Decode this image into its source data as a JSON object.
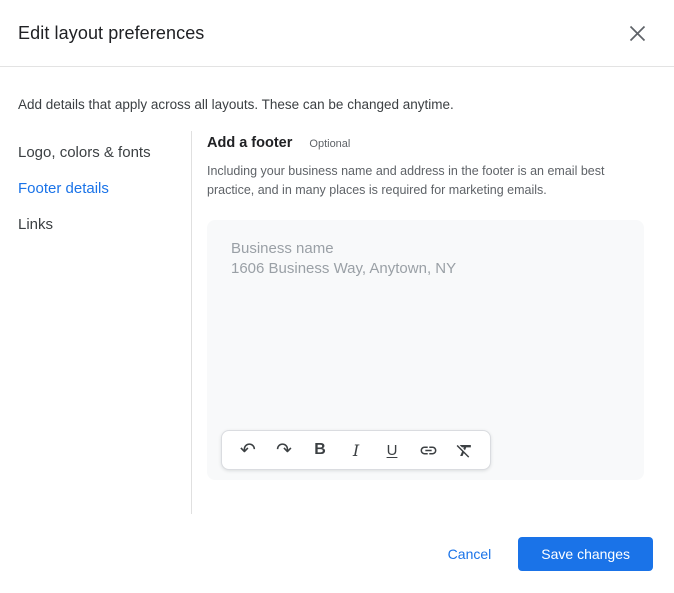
{
  "dialog": {
    "title": "Edit layout preferences",
    "intro": "Add details that apply across all layouts. These can be changed anytime."
  },
  "sidebar": {
    "items": [
      {
        "label": "Logo, colors & fonts",
        "selected": false
      },
      {
        "label": "Footer details",
        "selected": true
      },
      {
        "label": "Links",
        "selected": false
      }
    ]
  },
  "content": {
    "section_title": "Add a footer",
    "optional_label": "Optional",
    "description": "Including your business name and address in the footer is an email best practice, and in many places is required for marketing emails.",
    "editor": {
      "placeholder_line1": "Business name",
      "placeholder_line2": "1606 Business Way, Anytown, NY"
    },
    "toolbar": {
      "undo_glyph": "↶",
      "redo_glyph": "↷",
      "bold_glyph": "B",
      "italic_glyph": "I",
      "underline_glyph": "U"
    }
  },
  "footer": {
    "cancel_label": "Cancel",
    "save_label": "Save changes"
  },
  "colors": {
    "accent_blue": "#1a73e8",
    "text_primary": "#202124",
    "text_secondary": "#5f6368",
    "editor_background": "#f8f9fa",
    "placeholder_text": "#9aa0a6",
    "divider": "#e0e0e0"
  }
}
